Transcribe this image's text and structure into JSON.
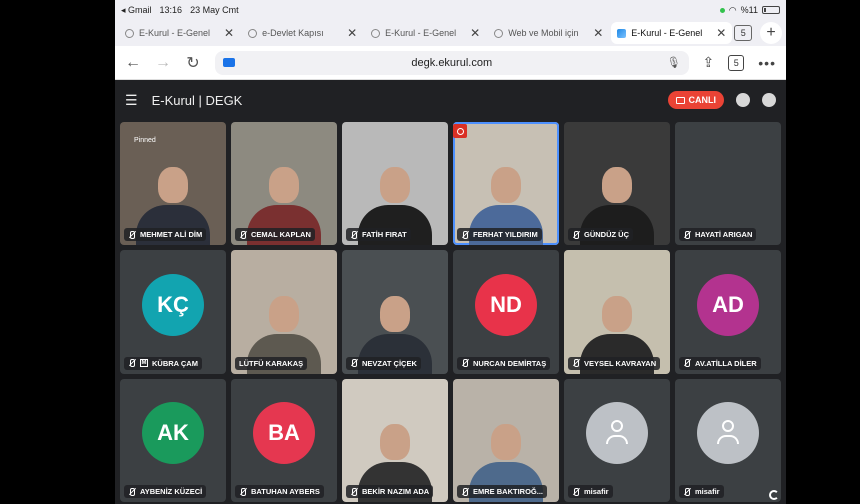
{
  "status_bar": {
    "back_app": "◂ Gmail",
    "time": "13:16",
    "date": "23 May Cmt",
    "battery": "%11"
  },
  "browser": {
    "tabs": [
      {
        "label": "E-Kurul - E-Genel",
        "active": false
      },
      {
        "label": "e-Devlet Kapısı",
        "active": false
      },
      {
        "label": "E-Kurul - E-Genel",
        "active": false
      },
      {
        "label": "Web ve Mobil için",
        "active": false
      },
      {
        "label": "E-Kurul - E-Genel",
        "active": true
      }
    ],
    "tab_count": "5",
    "url": "degk.ekurul.com"
  },
  "app": {
    "title": "E-Kurul | DEGK",
    "live_label": "CANLI"
  },
  "participants": [
    {
      "name": "MEHMET ALİ DİM",
      "type": "video",
      "bg": "#6a5f55",
      "shirt": "#2b2f3a",
      "pinned_label": "Pinned"
    },
    {
      "name": "CEMAL KAPLAN",
      "type": "video",
      "bg": "#8d8a80",
      "shirt": "#7a3030"
    },
    {
      "name": "FATİH FIRAT",
      "type": "video",
      "bg": "#b9b9b9",
      "shirt": "#1f1f1f"
    },
    {
      "name": "FERHAT YILDIRIM",
      "type": "video",
      "bg": "#c7c0b4",
      "shirt": "#4c6a9a",
      "active": true,
      "pin_red": true
    },
    {
      "name": "GÜNDÜZ ÜÇ",
      "type": "video",
      "bg": "#3a3a3a",
      "shirt": "#1d1d1d"
    },
    {
      "name": "HAYATİ ARIGAN",
      "type": "empty"
    },
    {
      "name": "KÜBRA ÇAM",
      "type": "avatar",
      "initials": "KÇ",
      "color": "#12a4b0",
      "moderator": true
    },
    {
      "name": "LÜTFÜ KARAKAŞ",
      "type": "video",
      "bg": "#b8aea1",
      "shirt": "#5d5950",
      "no_mic": true
    },
    {
      "name": "NEVZAT ÇİÇEK",
      "type": "video",
      "bg": "#4a4f52",
      "shirt": "#2b3038"
    },
    {
      "name": "NURCAN DEMİRTAŞ",
      "type": "avatar",
      "initials": "ND",
      "color": "#e8334a"
    },
    {
      "name": "VEYSEL KAVRAYAN",
      "type": "video",
      "bg": "#c5bfae",
      "shirt": "#2a2a2a"
    },
    {
      "name": "AV.ATİLLA DİLER",
      "type": "avatar",
      "initials": "AD",
      "color": "#b3338f"
    },
    {
      "name": "AYBENİZ KÜZECİ",
      "type": "avatar",
      "initials": "AK",
      "color": "#1a9a5c"
    },
    {
      "name": "BATUHAN AYBERS",
      "type": "avatar",
      "initials": "BA",
      "color": "#e53750"
    },
    {
      "name": "BEKİR NAZIM ADA",
      "type": "video",
      "bg": "#d0cac0",
      "shirt": "#333333"
    },
    {
      "name": "EMRE BAKTIROĞ...",
      "type": "video",
      "bg": "#b9b2a8",
      "shirt": "#4e6a8c"
    },
    {
      "name": "misafir",
      "type": "guest"
    },
    {
      "name": "misafir",
      "type": "guest",
      "loader": true
    }
  ]
}
